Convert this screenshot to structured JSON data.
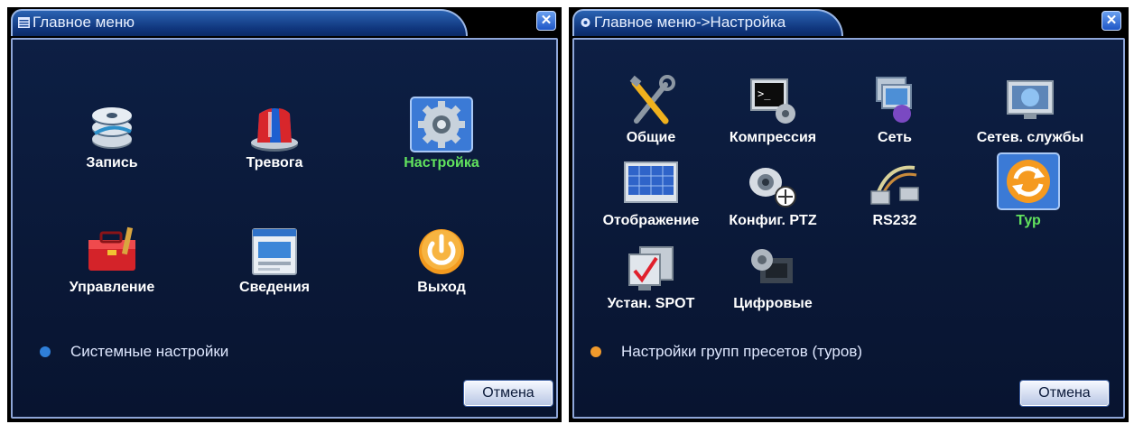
{
  "main_menu": {
    "title": "Главное меню",
    "close_label": "✕",
    "items": [
      {
        "label": "Запись",
        "icon": "recording-reels-icon"
      },
      {
        "label": "Тревога",
        "icon": "alarm-siren-icon"
      },
      {
        "label": "Настройка",
        "icon": "gear-icon"
      },
      {
        "label": "Управление",
        "icon": "toolbox-icon"
      },
      {
        "label": "Сведения",
        "icon": "info-window-icon"
      },
      {
        "label": "Выход",
        "icon": "power-icon"
      }
    ],
    "selected": "Настройка",
    "status_text": "Системные настройки",
    "cancel_label": "Отмена"
  },
  "settings_menu": {
    "title": "Главное меню->Настройка",
    "close_label": "✕",
    "items": [
      {
        "label": "Общие",
        "icon": "tools-icon"
      },
      {
        "label": "Компрессия",
        "icon": "terminal-gear-icon"
      },
      {
        "label": "Сеть",
        "icon": "network-icon"
      },
      {
        "label": "Сетев. службы",
        "icon": "globe-monitor-icon"
      },
      {
        "label": "Отображение",
        "icon": "display-grid-icon"
      },
      {
        "label": "Конфиг. PTZ",
        "icon": "ptz-camera-icon"
      },
      {
        "label": "RS232",
        "icon": "serial-cable-icon"
      },
      {
        "label": "Тур",
        "icon": "tour-refresh-icon"
      },
      {
        "label": "Устан. SPOT",
        "icon": "spot-monitor-icon"
      },
      {
        "label": "Цифровые",
        "icon": "digital-camera-icon"
      }
    ],
    "selected": "Тур",
    "status_text": "Настройки групп пресетов (туров)",
    "cancel_label": "Отмена"
  },
  "colors": {
    "panel_bg": "#0a1837",
    "selected_text": "#62e35e",
    "titlebar": "#10367d",
    "left_status_dot": "#2f7fd8",
    "right_status_dot": "#f09a2c"
  }
}
